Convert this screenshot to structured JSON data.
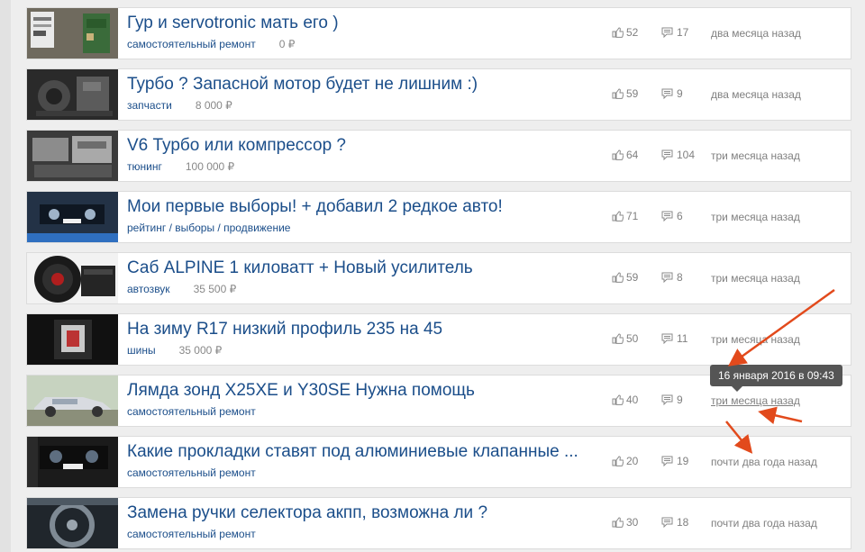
{
  "tooltip": {
    "text": "16 января 2016 в 09:43"
  },
  "colors": {
    "title": "#1b4e8a",
    "muted": "#808080",
    "annotation": "#e24a1c",
    "tooltip_bg": "#555555"
  },
  "icons": {
    "likes": "thumbs-up-icon",
    "comments": "comment-icon"
  },
  "posts": [
    {
      "title": "Гур и servotronic мать его )",
      "category": "самостоятельный ремонт",
      "price": "0 ₽",
      "likes": "52",
      "comments": "17",
      "time": "два месяца назад"
    },
    {
      "title": "Турбо ? Запасной мотор будет не лишним :)",
      "category": "запчасти",
      "price": "8 000 ₽",
      "likes": "59",
      "comments": "9",
      "time": "два месяца назад"
    },
    {
      "title": "V6 Турбо или компрессор ?",
      "category": "тюнинг",
      "price": "100 000 ₽",
      "likes": "64",
      "comments": "104",
      "time": "три месяца назад"
    },
    {
      "title": "Мои первые выборы! + добавил 2 редкое авто!",
      "category": "рейтинг / выборы / продвижение",
      "price": "",
      "likes": "71",
      "comments": "6",
      "time": "три месяца назад"
    },
    {
      "title": "Саб ALPINE 1 киловатт + Новый усилитель",
      "category": "автозвук",
      "price": "35 500 ₽",
      "likes": "59",
      "comments": "8",
      "time": "три месяца назад"
    },
    {
      "title": "На зиму R17 низкий профиль 235 на 45",
      "category": "шины",
      "price": "35 000 ₽",
      "likes": "50",
      "comments": "11",
      "time": "три месяца назад"
    },
    {
      "title": "Лямда зонд X25XE и Y30SE Нужна помощь",
      "category": "самостоятельный ремонт",
      "price": "",
      "likes": "40",
      "comments": "9",
      "time": "три месяца назад"
    },
    {
      "title": "Какие прокладки ставят под алюминиевые клапанные ...",
      "category": "самостоятельный ремонт",
      "price": "",
      "likes": "20",
      "comments": "19",
      "time": "почти два года назад"
    },
    {
      "title": "Замена ручки селектора акпп, возможна ли ?",
      "category": "самостоятельный ремонт",
      "price": "",
      "likes": "30",
      "comments": "18",
      "time": "почти два года назад"
    }
  ]
}
